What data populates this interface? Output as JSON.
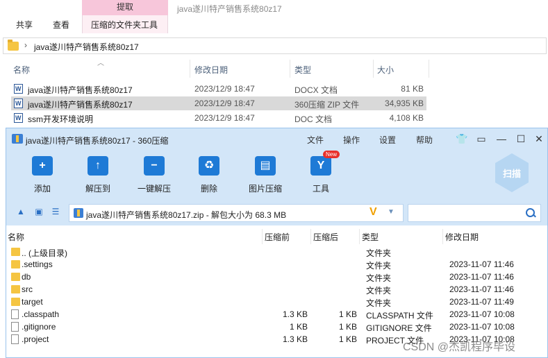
{
  "explorer": {
    "context_tab_header": "提取",
    "window_title": "java遂川特产销售系统80z17",
    "tabs": [
      "共享",
      "查看",
      "压缩的文件夹工具"
    ],
    "address_path": "java遂川特产销售系统80z17",
    "columns": {
      "name": "名称",
      "date": "修改日期",
      "type": "类型",
      "size": "大小"
    },
    "files": [
      {
        "name": "java遂川特产销售系统80z17",
        "date": "2023/12/9 18:47",
        "type": "DOCX 文档",
        "size": "81 KB",
        "selected": false
      },
      {
        "name": "java遂川特产销售系统80z17",
        "date": "2023/12/9 18:47",
        "type": "360压缩 ZIP 文件",
        "size": "34,935 KB",
        "selected": true
      },
      {
        "name": "ssm开发环境说明",
        "date": "2023/12/9 18:47",
        "type": "DOC 文档",
        "size": "4,108 KB",
        "selected": false
      }
    ]
  },
  "zip": {
    "title": "java遂川特产销售系统80z17 - 360压缩",
    "menu": {
      "file": "文件",
      "operate": "操作",
      "settings": "设置",
      "help": "帮助"
    },
    "toolbar": {
      "add": "添加",
      "extract_to": "解压到",
      "one_click": "一键解压",
      "delete": "删除",
      "image_compress": "图片压缩",
      "tools": "工具",
      "new_badge": "New",
      "scan": "扫描"
    },
    "path_text": "java遂川特产销售系统80z17.zip - 解包大小为 68.3 MB",
    "path_badge": "V",
    "search_placeholder": "",
    "columns": {
      "name": "名称",
      "before": "压缩前",
      "after": "压缩后",
      "type": "类型",
      "date": "修改日期"
    },
    "rows": [
      {
        "name": ".. (上级目录)",
        "before": "",
        "after": "",
        "type": "文件夹",
        "date": "",
        "kind": "folder"
      },
      {
        "name": ".settings",
        "before": "",
        "after": "",
        "type": "文件夹",
        "date": "2023-11-07 11:46",
        "kind": "folder"
      },
      {
        "name": "db",
        "before": "",
        "after": "",
        "type": "文件夹",
        "date": "2023-11-07 11:46",
        "kind": "folder"
      },
      {
        "name": "src",
        "before": "",
        "after": "",
        "type": "文件夹",
        "date": "2023-11-07 11:46",
        "kind": "folder"
      },
      {
        "name": "target",
        "before": "",
        "after": "",
        "type": "文件夹",
        "date": "2023-11-07 11:49",
        "kind": "folder"
      },
      {
        "name": ".classpath",
        "before": "1.3 KB",
        "after": "1 KB",
        "type": "CLASSPATH 文件",
        "date": "2023-11-07 10:08",
        "kind": "file"
      },
      {
        "name": ".gitignore",
        "before": "1 KB",
        "after": "1 KB",
        "type": "GITIGNORE 文件",
        "date": "2023-11-07 10:08",
        "kind": "file"
      },
      {
        "name": ".project",
        "before": "1.3 KB",
        "after": "1 KB",
        "type": "PROJECT 文件",
        "date": "2023-11-07 10:08",
        "kind": "file"
      }
    ]
  },
  "watermark": "CSDN @杰凯程序毕设"
}
